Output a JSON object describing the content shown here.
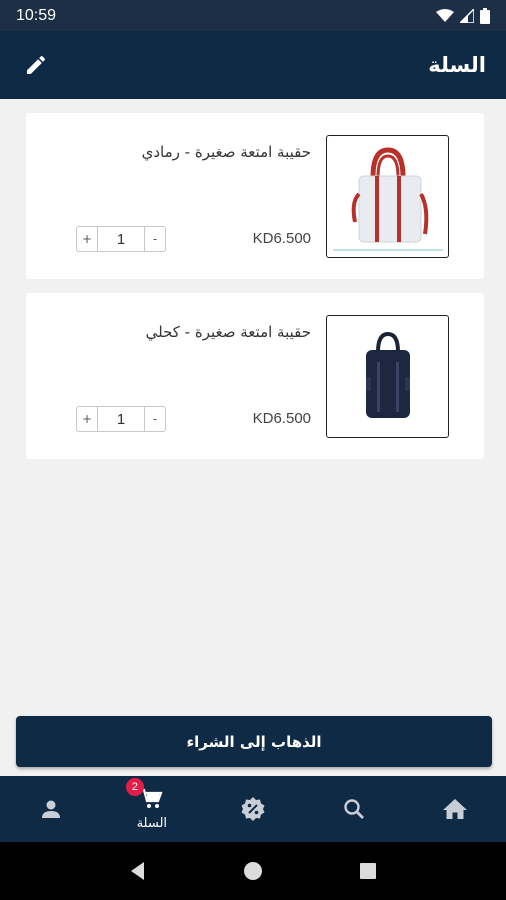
{
  "status_bar": {
    "time": "10:59"
  },
  "app_bar": {
    "title": "السلة",
    "edit_icon": "pencil-icon"
  },
  "cart_items": [
    {
      "name": "حقيبة امتعة صغيرة - رمادي",
      "price": "KD6.500",
      "quantity": "1",
      "plus": "+",
      "minus": "-",
      "image": "grey-tote-bag-red-straps"
    },
    {
      "name": "حقيبة امتعة صغيرة - كحلي",
      "price": "KD6.500",
      "quantity": "1",
      "plus": "+",
      "minus": "-",
      "image": "navy-backpack"
    }
  ],
  "checkout": {
    "label": "الذهاب إلى الشراء"
  },
  "bottom_nav": {
    "items": [
      {
        "icon": "home-icon",
        "label": ""
      },
      {
        "icon": "search-icon",
        "label": ""
      },
      {
        "icon": "discount-icon",
        "label": ""
      },
      {
        "icon": "cart-icon",
        "label": "السلة",
        "badge": "2",
        "active": true
      },
      {
        "icon": "user-icon",
        "label": ""
      }
    ]
  },
  "colors": {
    "primary": "#0f2a45",
    "status_bar": "#1c2f45",
    "background": "#f1f1f2",
    "badge": "#e21d48"
  }
}
